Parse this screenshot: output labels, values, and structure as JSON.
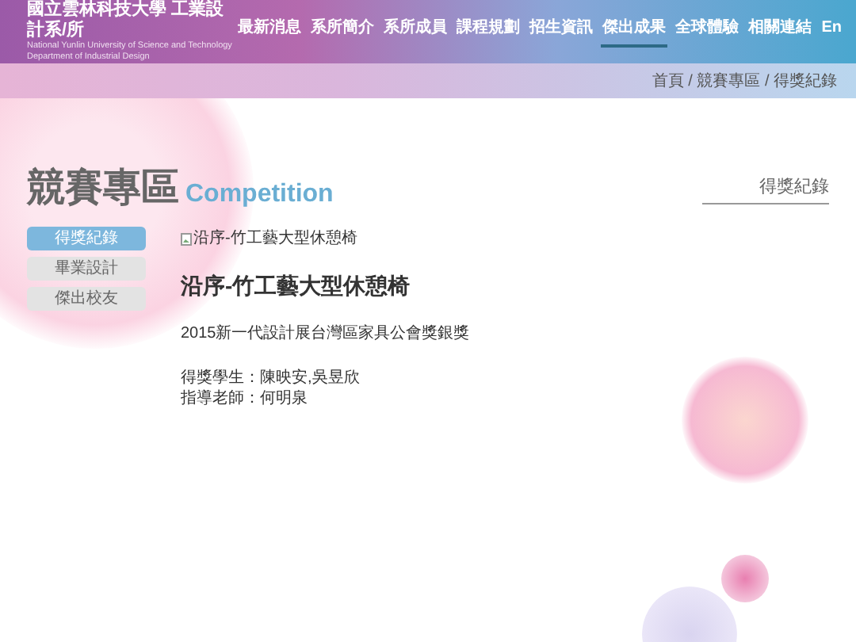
{
  "header": {
    "title": "國立雲林科技大學 工業設計系/所",
    "subtitle_lines": [
      "National Yunlin University of Science and Technology",
      "Department of Industrial Design"
    ]
  },
  "nav": [
    {
      "label": "最新消息",
      "selected": false
    },
    {
      "label": "系所簡介",
      "selected": false
    },
    {
      "label": "系所成員",
      "selected": false
    },
    {
      "label": "課程規劃",
      "selected": false
    },
    {
      "label": "招生資訊",
      "selected": false
    },
    {
      "label": "傑出成果",
      "selected": true
    },
    {
      "label": "全球體驗",
      "selected": false
    },
    {
      "label": "相關連結",
      "selected": false
    },
    {
      "label": "En",
      "selected": false
    }
  ],
  "breadcrumb": "首頁 / 競賽專區 / 得獎紀錄",
  "page_title": {
    "main": "競賽專區",
    "english": "Competition"
  },
  "section_label": "得獎紀錄",
  "side_menu": [
    {
      "label": "得獎紀錄",
      "selected": true
    },
    {
      "label": "畢業設計",
      "selected": false
    },
    {
      "label": "傑出校友",
      "selected": false
    }
  ],
  "article": {
    "image_alt": "沿序-竹工藝大型休憩椅",
    "title": "沿序-竹工藝大型休憩椅",
    "award": "2015新一代設計展台灣區家具公會獎銀獎",
    "credits": [
      "得獎學生：陳映安,吳昱欣",
      "指導老師：何明泉"
    ]
  }
}
